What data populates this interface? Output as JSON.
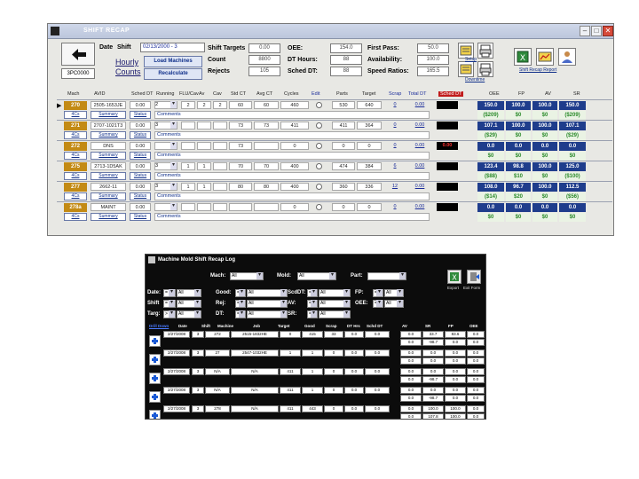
{
  "shift_recap": {
    "title": "SHIFT RECAP",
    "shift_number": "3PC0000",
    "date_label": "Date",
    "shift_label": "Shift",
    "date_value": "02/13/2000 - 3",
    "hourly_link": "Hourly",
    "counts_link": "Counts",
    "load_machines_label": "Load Machines",
    "recalculate_label": "Recalculate",
    "shift_targets_label": "Shift Targets",
    "shift_targets_value": "0.00",
    "count_label": "Count",
    "count_value": "8800",
    "rejects_label": "Rejects",
    "rejects_value": "105",
    "avg_ct_label": "Avg CT",
    "avg_ct_value": "0.00",
    "oee_label": "OEE:",
    "oee_value": "154.0",
    "dt_hours_label": "DT Hours:",
    "dt_hours_value": "88",
    "sched_dt_label": "Sched DT:",
    "sched_dt_value": "88",
    "first_pass_label": "First Pass:",
    "first_pass_value": "50.0",
    "availability_label": "Availability:",
    "availability_value": "100.0",
    "speed_ratios_label": "Speed Ratios:",
    "speed_ratios_value": "165.5",
    "tool_caption_1": "Setup",
    "tool_caption_2": "Downtime",
    "report_caption": "Shift Recap Report",
    "grid": {
      "headers": [
        "Mach",
        "AVID",
        "Sched DT",
        "Running",
        "FLU/Cav",
        "Av",
        "Cav",
        "Std CT",
        "Avg CT",
        "Cycles",
        "Edit",
        "Parts",
        "Target",
        "Scrap",
        "Total DT",
        "Sched DT",
        "OEE",
        "FP",
        "AV",
        "SR"
      ],
      "rows": [
        {
          "machine": "270",
          "job": "2505-1653JE",
          "sched_dt": "0.00",
          "running": "2",
          "fluc": "2",
          "av": "2",
          "cav": "2",
          "std_ct": "60",
          "avg_ct": "60",
          "cycles": "460",
          "parts": "530",
          "target": "640",
          "scrap": "0",
          "total_dt": "0.00",
          "dt_sched": "",
          "btn_a": "4Cs",
          "btn_b": "Summary",
          "btn_c": "Status",
          "comment": "Comments",
          "oee": "150.0",
          "fp": "100.0",
          "avail": "100.0",
          "sr": "150.0",
          "oee2": "($209)",
          "fp2": "$0",
          "avail2": "$0",
          "sr2": "($209)"
        },
        {
          "machine": "271",
          "job": "2707-1021T3",
          "sched_dt": "0.00",
          "running": "3",
          "fluc": "",
          "av": "",
          "cav": "",
          "std_ct": "73",
          "avg_ct": "73",
          "cycles": "411",
          "parts": "411",
          "target": "364",
          "scrap": "0",
          "total_dt": "0.00",
          "dt_sched": "",
          "btn_a": "4Cs",
          "btn_b": "Summary",
          "btn_c": "Status",
          "comment": "Comments",
          "oee": "107.1",
          "fp": "100.0",
          "avail": "100.0",
          "sr": "107.1",
          "oee2": "($29)",
          "fp2": "$0",
          "avail2": "$0",
          "sr2": "($29)"
        },
        {
          "machine": "272",
          "job": "DNS",
          "sched_dt": "0.00",
          "running": "",
          "fluc": "",
          "av": "",
          "cav": "",
          "std_ct": "73",
          "avg_ct": "",
          "cycles": "0",
          "parts": "0",
          "target": "0",
          "scrap": "0",
          "total_dt": "0.00",
          "dt_sched": "0.00",
          "btn_a": "4Cs",
          "btn_b": "Summary",
          "btn_c": "Status",
          "comment": "Comments",
          "oee": "0.0",
          "fp": "0.0",
          "avail": "0.0",
          "sr": "0.0",
          "oee2": "$0",
          "fp2": "$0",
          "avail2": "$0",
          "sr2": "$0"
        },
        {
          "machine": "275",
          "job": "2713-1D5AK",
          "sched_dt": "0.00",
          "running": "3",
          "fluc": "1",
          "av": "1",
          "cav": "",
          "std_ct": "70",
          "avg_ct": "70",
          "cycles": "400",
          "parts": "474",
          "target": "384",
          "scrap": "6",
          "total_dt": "0.00",
          "dt_sched": "",
          "btn_a": "4Cs",
          "btn_b": "Summary",
          "btn_c": "Status",
          "comment": "Comments",
          "oee": "123.4",
          "fp": "98.8",
          "avail": "100.0",
          "sr": "125.0",
          "oee2": "($88)",
          "fp2": "$10",
          "avail2": "$0",
          "sr2": "($100)"
        },
        {
          "machine": "277",
          "job": "2662-11",
          "sched_dt": "0.00",
          "running": "3",
          "fluc": "1",
          "av": "1",
          "cav": "",
          "std_ct": "80",
          "avg_ct": "80",
          "cycles": "400",
          "parts": "360",
          "target": "336",
          "scrap": "12",
          "total_dt": "0.00",
          "dt_sched": "",
          "btn_a": "4Cs",
          "btn_b": "Summary",
          "btn_c": "Status",
          "comment": "Comments",
          "oee": "108.0",
          "fp": "96.7",
          "avail": "100.0",
          "sr": "112.5",
          "oee2": "($14)",
          "fp2": "$20",
          "avail2": "$0",
          "sr2": "($56)"
        },
        {
          "machine": "278a",
          "job": "MAINT",
          "sched_dt": "0.00",
          "running": "",
          "fluc": "",
          "av": "",
          "cav": "",
          "std_ct": "",
          "avg_ct": "",
          "cycles": "0",
          "parts": "0",
          "target": "0",
          "scrap": "0",
          "total_dt": "0.00",
          "dt_sched": "",
          "btn_a": "4Cs",
          "btn_b": "Summary",
          "btn_c": "Status",
          "comment": "Comments",
          "oee": "0.0",
          "fp": "0.0",
          "avail": "0.0",
          "sr": "0.0",
          "oee2": "$0",
          "fp2": "$0",
          "avail2": "$0",
          "sr2": "$0"
        }
      ]
    }
  },
  "mold_log": {
    "title": "Machine Mold Shift Recap Log",
    "mach_label": "Mach:",
    "mold_label": "Mold:",
    "part_label": "Part:",
    "mach_value": "All",
    "mold_value": "All",
    "part_value": "",
    "export_caption": "Export",
    "exit_caption": "Exit Form",
    "filters": {
      "date_label": "Date:",
      "good_label": "Good:",
      "scddt_label": "ScdDT:",
      "fp_label": "FP:",
      "shift_label": "Shift",
      "rej_label": "Rej:",
      "av_label": "AV:",
      "oee_label": "OEE:",
      "targ_label": "Targ:",
      "dt_label": "DT:",
      "sr_label": "SR:",
      "date_op": "=",
      "shift_op": "=",
      "targ_op": ">",
      "good_op": "=",
      "rej_op": "=",
      "dt_op": "=",
      "scddt_op": "=",
      "av_op": "=",
      "sr_op": "=",
      "fp_op": "=",
      "oee_op": "=",
      "fill_value": "All"
    },
    "grid": {
      "headers": [
        "Drill Down",
        "Date",
        "Shift",
        "Machine",
        "Job",
        "Target",
        "Good",
        "Scrap",
        "DT Hrs",
        "Schd DT",
        "AV",
        "SR",
        "FP",
        "OEE"
      ],
      "rows": [
        {
          "date": "2/27/2008",
          "shift": "3",
          "machine": "272",
          "job": "2515-1832HE",
          "target": "0",
          "good": "415",
          "scrap": "33",
          "dt": "0.0",
          "sched": "0.0",
          "av": "0.0",
          "sr": "33.7",
          "fp": "83.6",
          "oee": "0.0",
          "av2": "0.0",
          "sr2": "-98.7",
          "fp2": "0.0",
          "oee2": "0.0"
        },
        {
          "date": "2/27/2008",
          "shift": "3",
          "machine": "27",
          "job": "2547-1032HE",
          "target": "1",
          "good": "1",
          "scrap": "0",
          "dt": "0.0",
          "sched": "0.0",
          "av": "0.0",
          "sr": "0.0",
          "fp": "0.0",
          "oee": "0.0",
          "av2": "0.0",
          "sr2": "0.0",
          "fp2": "0.0",
          "oee2": "0.0"
        },
        {
          "date": "2/27/2008",
          "shift": "3",
          "machine": "N/A",
          "job": "N/A",
          "target": "411",
          "good": "1",
          "scrap": "0",
          "dt": "0.0",
          "sched": "0.0",
          "av": "0.0",
          "sr": "0.0",
          "fp": "0.0",
          "oee": "0.0",
          "av2": "0.0",
          "sr2": "-98.7",
          "fp2": "0.0",
          "oee2": "0.0"
        },
        {
          "date": "2/27/2008",
          "shift": "3",
          "machine": "N/A",
          "job": "N/A",
          "target": "411",
          "good": "1",
          "scrap": "0",
          "dt": "0.0",
          "sched": "0.0",
          "av": "0.0",
          "sr": "0.0",
          "fp": "0.0",
          "oee": "0.0",
          "av2": "0.0",
          "sr2": "-98.7",
          "fp2": "0.0",
          "oee2": "0.0"
        },
        {
          "date": "2/27/2008",
          "shift": "3",
          "machine": "278",
          "job": "N/A",
          "target": "411",
          "good": "443",
          "scrap": "0",
          "dt": "0.0",
          "sched": "0.0",
          "av": "0.0",
          "sr": "100.0",
          "fp": "100.0",
          "oee": "0.0",
          "av2": "0.0",
          "sr2": "107.8",
          "fp2": "100.0",
          "oee2": "0.0"
        }
      ],
      "final_row": {
        "av": "0.0",
        "sr": "-98.8",
        "fp": "0.0",
        "oee": "0.0"
      }
    }
  }
}
